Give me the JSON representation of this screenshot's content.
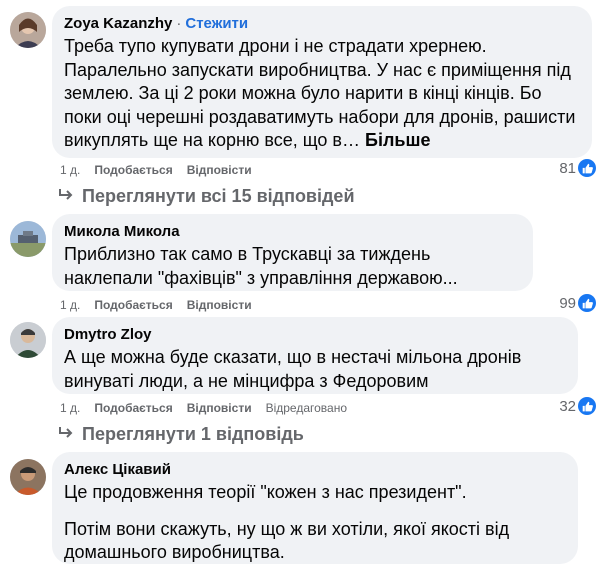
{
  "comments": [
    {
      "author": "Zoya Kazanzhy",
      "follow": "Стежити",
      "text": [
        "Треба тупо купувати дрони і не страдати хрернею. Паралельно запускати виробництва. У нас є приміщення під землею. За ці 2 роки можна було нарити в кінці кінців. Бо поки оці черешні роздаватимуть набори для дронів, рашисти викуплять ще на корню все, що в…"
      ],
      "more": "Більше",
      "time": "1 д.",
      "like": "Подобається",
      "reply": "Відповісти",
      "count": "81",
      "replies": "Переглянути всі 15 відповідей"
    },
    {
      "author": "Микола Микола",
      "text": [
        "Приблизно так само в Трускавці за тиждень наклепали \"фахівців\" з управління державою..."
      ],
      "time": "1 д.",
      "like": "Подобається",
      "reply": "Відповісти",
      "count": "99"
    },
    {
      "author": "Dmytro Zloy",
      "text": [
        "А ще можна буде сказати, що в нестачі мільона дронів винуваті люди, а не мінцифра з Федоровим"
      ],
      "time": "1 д.",
      "like": "Подобається",
      "reply": "Відповісти",
      "edited": "Відредаговано",
      "count": "32",
      "replies": "Переглянути 1 відповідь"
    },
    {
      "author": "Алекс Цікавий",
      "text": [
        "Це продовження теорії \"кожен з нас президент\".",
        "Потім вони скажуть, ну що ж ви хотіли, якої якості від домашнього виробництва."
      ]
    }
  ],
  "icons": {
    "like": "thumbs-up-icon",
    "reply_arrow": "reply-arrow-icon"
  },
  "colors": {
    "link": "#216fdb",
    "bubble": "#f0f2f5",
    "like": "#1877f2",
    "meta": "#65676b"
  }
}
